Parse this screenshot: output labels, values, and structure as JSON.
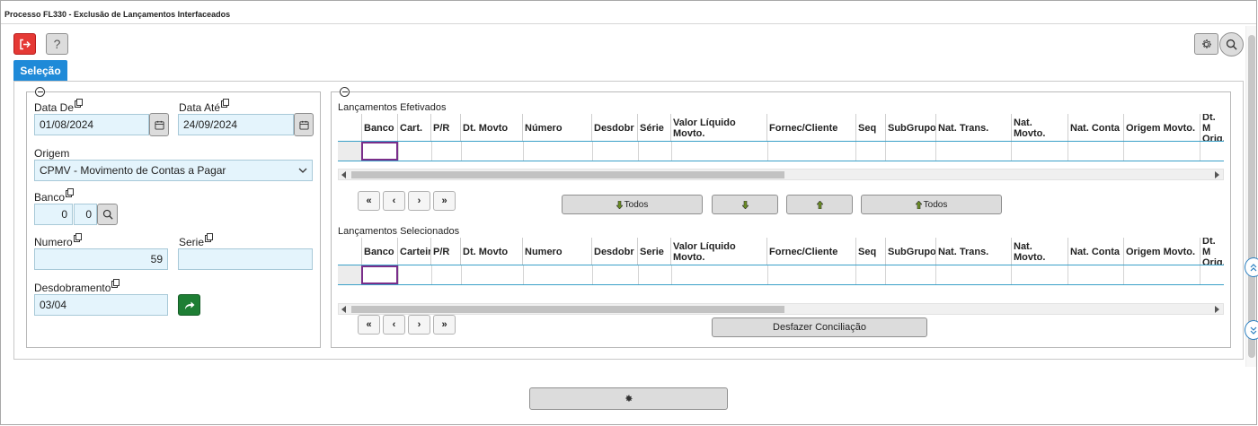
{
  "window": {
    "title": "Processo FL330 - Exclusão de Lançamentos Interfaceados"
  },
  "toolbar": {
    "help_label": "?"
  },
  "tabs": [
    {
      "label": "Seleção",
      "active": true
    }
  ],
  "form": {
    "data_de": {
      "label": "Data De",
      "value": "01/08/2024"
    },
    "data_ate": {
      "label": "Data Até",
      "value": "24/09/2024"
    },
    "origem": {
      "label": "Origem",
      "value": "CPMV - Movimento de Contas a Pagar"
    },
    "banco": {
      "label": "Banco",
      "value1": "0",
      "value2": "0"
    },
    "numero": {
      "label": "Numero",
      "value": "59"
    },
    "serie": {
      "label": "Serie",
      "value": ""
    },
    "desdobramento": {
      "label": "Desdobramento",
      "value": "03/04"
    }
  },
  "efetivados": {
    "title": "Lançamentos Efetivados",
    "columns": [
      "Banco",
      "Cart.",
      "P/R",
      "Dt. Movto",
      "Número",
      "Desdobr",
      "Série",
      "Valor Líquido Movto.",
      "Fornec/Cliente",
      "Seq",
      "SubGrupo",
      "Nat. Trans.",
      "Nat. Movto.",
      "Nat. Conta",
      "Origem Movto.",
      "Dt. M Orig."
    ],
    "nav": [
      "«",
      "‹",
      "›",
      "»"
    ],
    "actions": [
      "Todos",
      "",
      "",
      "Todos"
    ]
  },
  "selecionados": {
    "title": "Lançamentos Selecionados",
    "columns": [
      "Banco",
      "Carteira",
      "P/R",
      "Dt. Movto",
      "Numero",
      "Desdobr",
      "Serie",
      "Valor Líquido Movto.",
      "Fornec/Cliente",
      "Seq",
      "SubGrupo",
      "Nat. Trans.",
      "Nat. Movto.",
      "Nat. Conta",
      "Origem Movto.",
      "Dt. M Orig."
    ],
    "nav": [
      "«",
      "‹",
      "›",
      "»"
    ],
    "undo_label": "Desfazer Conciliação"
  },
  "colors": {
    "accent": "#1f8ad8",
    "exit": "#e53935",
    "go": "#1e7e34",
    "field_bg": "#e4f4fc",
    "selection": "#7a2e8a"
  }
}
